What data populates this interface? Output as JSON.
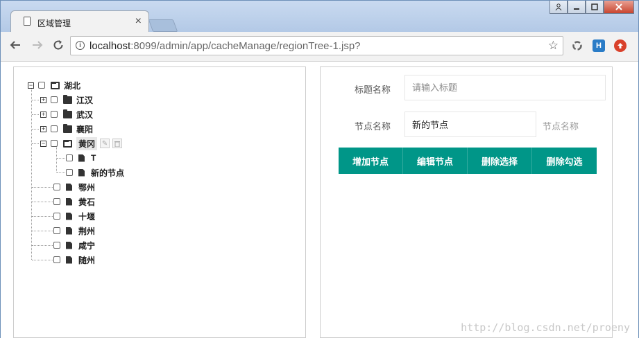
{
  "browser": {
    "tab_title": "区域管理",
    "tab_close": "×",
    "url_host": "localhost",
    "url_rest": ":8099/admin/app/cacheManage/regionTree-1.jsp?",
    "ext_h": "H"
  },
  "tree": {
    "root": "湖北",
    "children": [
      "江汉",
      "武汉",
      "襄阳",
      "黄冈",
      "鄂州",
      "黄石",
      "十堰",
      "荆州",
      "咸宁",
      "随州"
    ],
    "huanggang_children": [
      "T",
      "新的节点"
    ]
  },
  "form": {
    "title_label": "标题名称",
    "title_placeholder": "请输入标题",
    "node_label": "节点名称",
    "node_value": "新的节点",
    "node_hint": "节点名称"
  },
  "buttons": {
    "add": "增加节点",
    "edit": "编辑节点",
    "delete_selected": "删除选择",
    "delete_checked": "删除勾选"
  },
  "watermark": "http://blog.csdn.net/proeny",
  "colors": {
    "accent": "#009688"
  }
}
